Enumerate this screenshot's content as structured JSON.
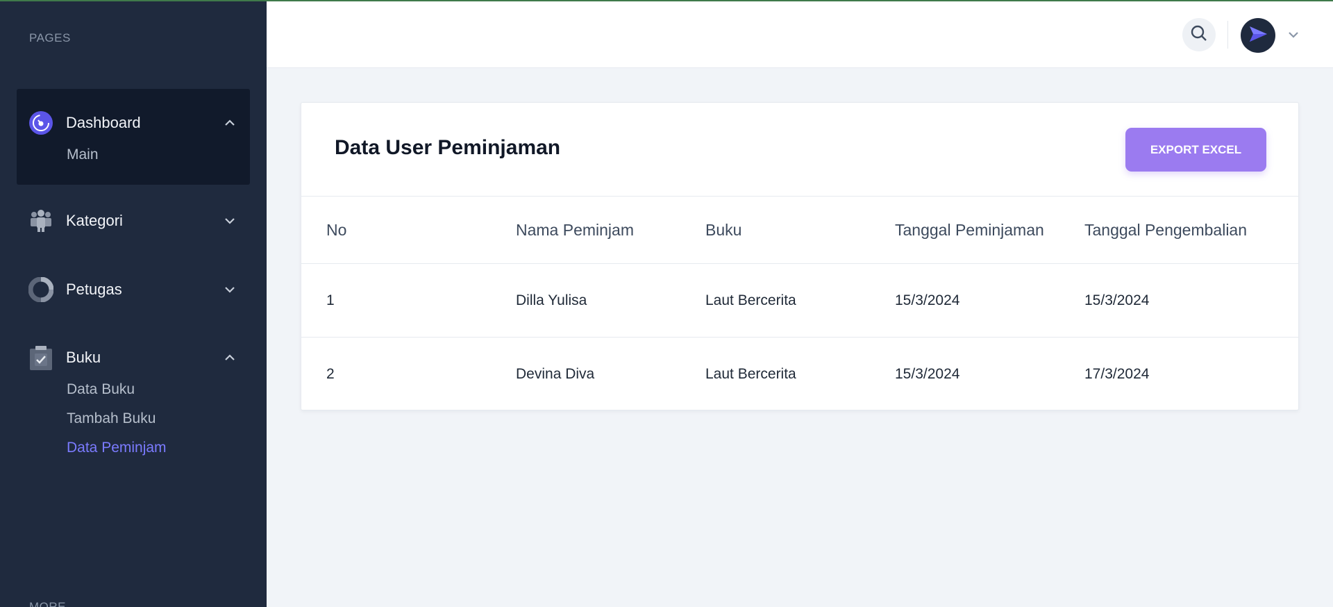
{
  "sidebar": {
    "section_pages": "PAGES",
    "section_more": "MORE",
    "groups": [
      {
        "label": "Dashboard",
        "items": [
          "Main"
        ]
      },
      {
        "label": "Kategori",
        "items": []
      },
      {
        "label": "Petugas",
        "items": []
      },
      {
        "label": "Buku",
        "items": [
          "Data Buku",
          "Tambah Buku",
          "Data Peminjam"
        ]
      }
    ]
  },
  "header": {
    "search_icon": "search-icon",
    "avatar_icon": "paper-plane-icon",
    "menu_icon": "chevron-down-icon"
  },
  "main": {
    "title": "Data User Peminjaman",
    "export_label": "EXPORT EXCEL",
    "table": {
      "columns": [
        "No",
        "Nama Peminjam",
        "Buku",
        "Tanggal Peminjaman",
        "Tanggal Pengembalian"
      ],
      "rows": [
        [
          "1",
          "Dilla Yulisa",
          "Laut Bercerita",
          "15/3/2024",
          "15/3/2024"
        ],
        [
          "2",
          "Devina Diva",
          "Laut Bercerita",
          "15/3/2024",
          "17/3/2024"
        ]
      ]
    }
  },
  "colors": {
    "sidebar_bg": "#1f2a3e",
    "active_bg": "#111a2b",
    "accent": "#7b7bff",
    "button": "#9b7bf0",
    "page_bg": "#f1f4f8"
  }
}
